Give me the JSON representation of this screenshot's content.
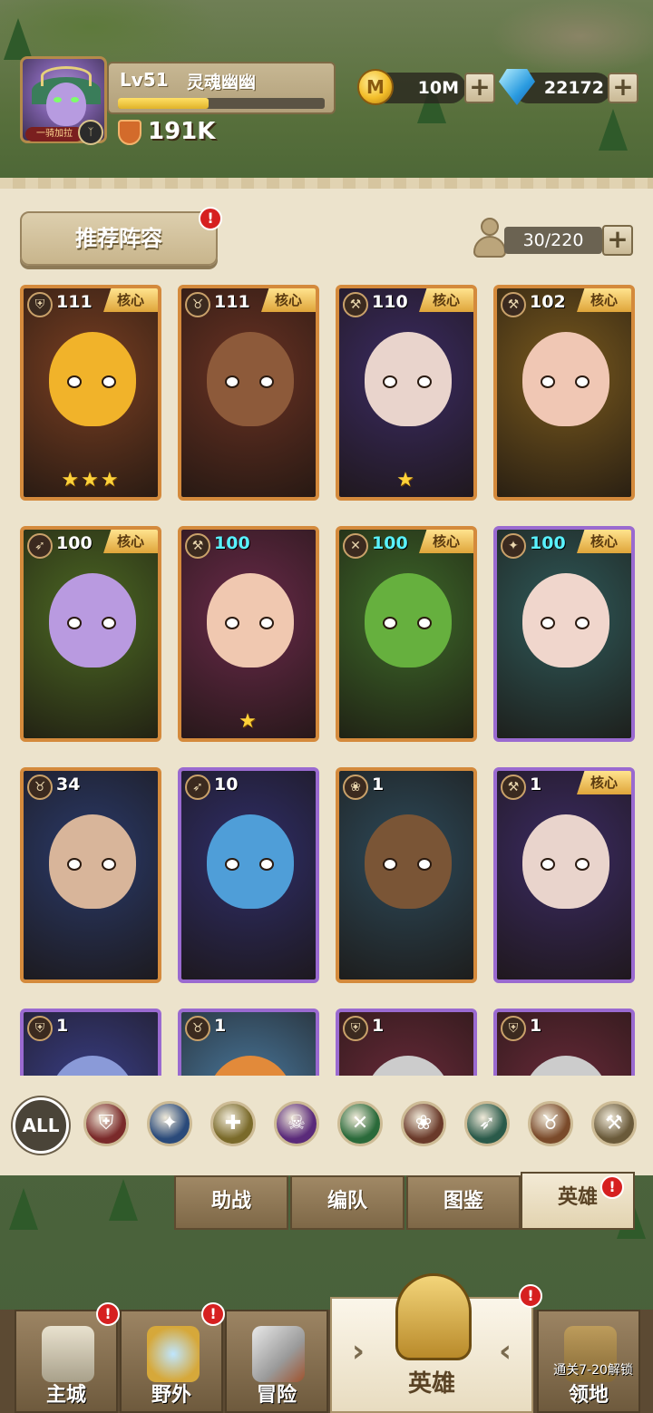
{
  "player": {
    "level": "Lv51",
    "name": "灵魂幽幽",
    "exp_progress": 0.44,
    "title": "一骑加拉",
    "rank_glyph": "ᛉ",
    "power": "191K"
  },
  "resources": {
    "gold": {
      "icon": "gold-coin-icon",
      "glyph": "M",
      "value": "10M"
    },
    "gems": {
      "icon": "diamond-gem-icon",
      "value": "22172"
    },
    "plus": "+"
  },
  "panel": {
    "recommend_label": "推荐阵容",
    "alert": "!",
    "slots": "30/220"
  },
  "heroes": [
    {
      "class": "shield",
      "level": "111",
      "core": "核心",
      "stars": "★★★",
      "frame": "orange",
      "bg": "#7a3f22",
      "skin": "#f1b32a"
    },
    {
      "class": "warrior",
      "level": "111",
      "core": "核心",
      "stars": "",
      "frame": "orange",
      "bg": "#6a3223",
      "skin": "#8d5a3a"
    },
    {
      "class": "axe",
      "level": "110",
      "core": "核心",
      "stars": "★",
      "frame": "orange",
      "bg": "#3b2b63",
      "skin": "#e9d4cc"
    },
    {
      "class": "axe",
      "level": "102",
      "core": "核心",
      "stars": "",
      "frame": "orange",
      "bg": "#7a5a1e",
      "skin": "#f0c7b4"
    },
    {
      "class": "bow",
      "level": "100",
      "core": "核心",
      "stars": "",
      "frame": "orange",
      "bg": "#4d6a24",
      "skin": "#b99ae0"
    },
    {
      "class": "axe",
      "level": "100",
      "core": "",
      "stars": "★",
      "frame": "orange",
      "bg": "#6a2a4a",
      "skin": "#f0c8b0",
      "cyan": true
    },
    {
      "class": "dagger",
      "level": "100",
      "core": "核心",
      "stars": "",
      "frame": "orange",
      "bg": "#3e6a2a",
      "skin": "#66b03e",
      "cyan": true
    },
    {
      "class": "staff",
      "level": "100",
      "core": "核心",
      "stars": "",
      "frame": "purple",
      "bg": "#2f5a5a",
      "skin": "#f0d6cc",
      "cyan": true
    },
    {
      "class": "beast",
      "level": "34",
      "core": "",
      "stars": "",
      "frame": "orange",
      "bg": "#2a3a6a",
      "skin": "#d8b59a"
    },
    {
      "class": "bow",
      "level": "10",
      "core": "",
      "stars": "",
      "frame": "purple",
      "bg": "#2f2e6a",
      "skin": "#4f9ed8"
    },
    {
      "class": "paw",
      "level": "1",
      "core": "",
      "stars": "",
      "frame": "orange",
      "bg": "#2d4a5a",
      "skin": "#7a5536"
    },
    {
      "class": "axe",
      "level": "1",
      "core": "核心",
      "stars": "",
      "frame": "purple",
      "bg": "#3b2b63",
      "skin": "#e9d4cc"
    },
    {
      "class": "shield",
      "level": "1",
      "core": "",
      "stars": "",
      "frame": "purple",
      "bg": "#3a3f8a",
      "skin": "#8a9ad8"
    },
    {
      "class": "warrior",
      "level": "1",
      "core": "",
      "stars": "",
      "frame": "purple",
      "bg": "#4a7aa0",
      "skin": "#e28a3a"
    },
    {
      "class": "shield",
      "level": "1",
      "core": "",
      "stars": "",
      "frame": "purple",
      "bg": "#6a2a3a",
      "skin": "#ccc"
    },
    {
      "class": "shield",
      "level": "1",
      "core": "",
      "stars": "",
      "frame": "purple",
      "bg": "#6a2a3a",
      "skin": "#ccc"
    }
  ],
  "filters": {
    "all_label": "ALL",
    "items": [
      {
        "icon": "shield-class-icon",
        "glyph": "⛨",
        "color": "#7a2a2a"
      },
      {
        "icon": "staff-class-icon",
        "glyph": "✦",
        "color": "#2a4a7a"
      },
      {
        "icon": "holy-class-icon",
        "glyph": "✚",
        "color": "#7a6a2a"
      },
      {
        "icon": "skull-class-icon",
        "glyph": "☠",
        "color": "#5a2a7a"
      },
      {
        "icon": "dagger-class-icon",
        "glyph": "✕",
        "color": "#2a6a3a"
      },
      {
        "icon": "paw-class-icon",
        "glyph": "❀",
        "color": "#6a3a2a"
      },
      {
        "icon": "bow-class-icon",
        "glyph": "➶",
        "color": "#2a5a4a"
      },
      {
        "icon": "beast-class-icon",
        "glyph": "♉",
        "color": "#7a4a2a"
      },
      {
        "icon": "axe-class-icon",
        "glyph": "⚒",
        "color": "#6a5a3a"
      }
    ]
  },
  "sub_tabs": [
    {
      "label": "助战"
    },
    {
      "label": "编队"
    },
    {
      "label": "图鉴"
    },
    {
      "label": "英雄"
    }
  ],
  "nav": {
    "main_city": "主城",
    "wild": "野外",
    "adventure": "冒险",
    "heroes": "英雄",
    "territory": "领地",
    "territory_lock": "通关7-20解锁",
    "arrow_left": "›",
    "arrow_right": "‹"
  }
}
